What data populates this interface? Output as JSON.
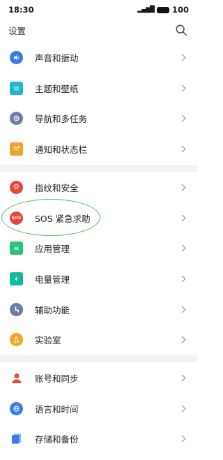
{
  "status_bar": {
    "time": "18:30",
    "signal": "4G",
    "battery": "100"
  },
  "header": {
    "title": "设置"
  },
  "groups": [
    {
      "items": [
        {
          "label": "声音和振动",
          "icon": "sound-icon",
          "color": "#3a7ce8"
        },
        {
          "label": "主题和壁纸",
          "icon": "theme-icon",
          "color": "#1fb8c9"
        },
        {
          "label": "导航和多任务",
          "icon": "navigation-icon",
          "color": "#6b7f9e"
        },
        {
          "label": "通知和状态栏",
          "icon": "notification-icon",
          "color": "#f0a42b"
        }
      ]
    },
    {
      "items": [
        {
          "label": "指纹和安全",
          "icon": "fingerprint-icon",
          "color": "#e8453c"
        },
        {
          "label": "SOS 紧急求助",
          "icon": "sos-icon",
          "color": "#e8453c",
          "sos_text": "SOS"
        },
        {
          "label": "应用管理",
          "icon": "app-management-icon",
          "color": "#2ec27e"
        },
        {
          "label": "电量管理",
          "icon": "battery-icon",
          "color": "#17b8a0"
        },
        {
          "label": "辅助功能",
          "icon": "accessibility-icon",
          "color": "#6b7f9e"
        },
        {
          "label": "实验室",
          "icon": "lab-icon",
          "color": "#f5a623"
        }
      ]
    },
    {
      "items": [
        {
          "label": "账号和同步",
          "icon": "account-icon",
          "color": "#e8453c"
        },
        {
          "label": "语言和时间",
          "icon": "language-icon",
          "color": "#3a7ce8"
        },
        {
          "label": "存储和备份",
          "icon": "storage-icon",
          "color": "#3a7ce8"
        }
      ]
    }
  ]
}
